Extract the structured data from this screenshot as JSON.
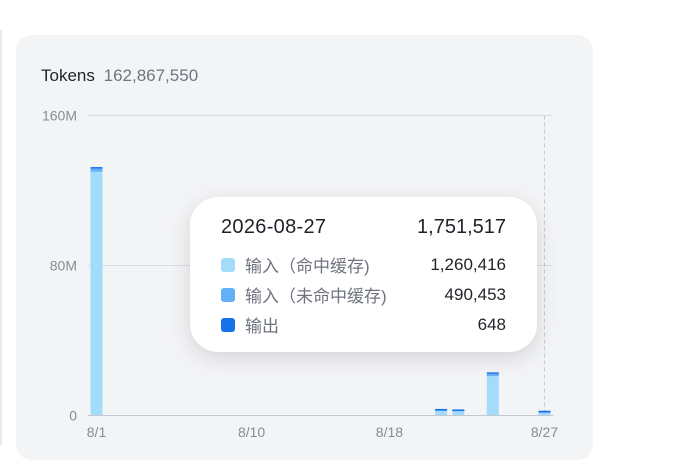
{
  "header": {
    "label": "Tokens",
    "total": "162,867,550"
  },
  "colors": {
    "cache_hit": "#a3dcfb",
    "cache_miss": "#64b0f6",
    "output": "#1672ea"
  },
  "tooltip": {
    "date": "2026-08-27",
    "total": "1,751,517",
    "items": [
      {
        "name": "输入（命中缓存)",
        "value": "1,260,416",
        "color": "#a3dcfb"
      },
      {
        "name": "输入（未命中缓存)",
        "value": "490,453",
        "color": "#64b0f6"
      },
      {
        "name": "输出",
        "value": "648",
        "color": "#1672ea"
      }
    ]
  },
  "chart_data": {
    "type": "bar",
    "stacked": true,
    "categories": [
      "8/1",
      "8/2",
      "8/3",
      "8/4",
      "8/5",
      "8/6",
      "8/7",
      "8/8",
      "8/9",
      "8/10",
      "8/11",
      "8/12",
      "8/13",
      "8/14",
      "8/15",
      "8/16",
      "8/17",
      "8/18",
      "8/19",
      "8/20",
      "8/21",
      "8/22",
      "8/23",
      "8/24",
      "8/25",
      "8/26",
      "8/27"
    ],
    "x_tick_labels": [
      "8/1",
      "8/10",
      "8/18",
      "8/27"
    ],
    "y_tick_labels": [
      "160M",
      "80M",
      "0"
    ],
    "ylim": [
      0,
      160000000
    ],
    "grid": true,
    "series": [
      {
        "name": "输入（命中缓存)",
        "color": "#a3dcfb",
        "values": [
          130000000,
          0,
          0,
          0,
          0,
          0,
          0,
          0,
          0,
          0,
          0,
          0,
          0,
          0,
          0,
          0,
          0,
          0,
          0,
          0,
          2400000,
          2200000,
          0,
          21000000,
          0,
          0,
          1260416
        ]
      },
      {
        "name": "输入（未命中缓存)",
        "color": "#64b0f6",
        "values": [
          1700000,
          0,
          0,
          0,
          0,
          0,
          0,
          0,
          0,
          0,
          0,
          0,
          0,
          0,
          0,
          0,
          0,
          0,
          0,
          0,
          300000,
          250000,
          0,
          1200000,
          0,
          0,
          490453
        ]
      },
      {
        "name": "输出",
        "color": "#1672ea",
        "values": [
          100000,
          0,
          0,
          0,
          0,
          0,
          0,
          0,
          0,
          0,
          0,
          0,
          0,
          0,
          0,
          0,
          0,
          0,
          0,
          0,
          10000,
          10000,
          0,
          30000,
          0,
          0,
          648
        ]
      }
    ],
    "hover_category": "8/27"
  }
}
